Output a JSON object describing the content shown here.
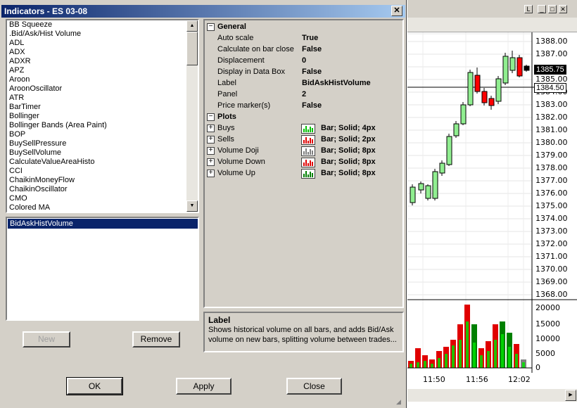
{
  "dialog": {
    "title": "Indicators - ES 03-08",
    "close_glyph": "✕",
    "indicator_list": [
      "BB Squeeze",
      ".Bid/Ask/Hist Volume",
      "ADL",
      "ADX",
      "ADXR",
      "APZ",
      "Aroon",
      "AroonOscillator",
      "ATR",
      "BarTimer",
      "Bollinger",
      "Bollinger Bands (Area Paint)",
      "BOP",
      "BuySellPressure",
      "BuySellVolume",
      "CalculateValueAreaHisto",
      "CCI",
      "ChaikinMoneyFlow",
      "ChaikinOscillator",
      "CMO",
      "Colored MA"
    ],
    "selected_indicators": [
      "BidAskHistVolume"
    ],
    "buttons": {
      "new": "New",
      "remove": "Remove",
      "ok": "OK",
      "apply": "Apply",
      "close": "Close"
    },
    "properties": {
      "general_label": "General",
      "general": [
        {
          "key": "Auto scale",
          "value": "True"
        },
        {
          "key": "Calculate on bar close",
          "value": "False"
        },
        {
          "key": "Displacement",
          "value": "0"
        },
        {
          "key": "Display in Data Box",
          "value": "False"
        },
        {
          "key": "Label",
          "value": "BidAskHistVolume"
        },
        {
          "key": "Panel",
          "value": "2"
        },
        {
          "key": "Price marker(s)",
          "value": "False"
        }
      ],
      "plots_label": "Plots",
      "plots": [
        {
          "key": "Buys",
          "value": "Bar; Solid; 4px",
          "color": "#00c000"
        },
        {
          "key": "Sells",
          "value": "Bar; Solid; 2px",
          "color": "#e00000"
        },
        {
          "key": "Volume Doji",
          "value": "Bar; Solid; 8px",
          "color": "#808080"
        },
        {
          "key": "Volume Down",
          "value": "Bar; Solid; 8px",
          "color": "#e00000"
        },
        {
          "key": "Volume Up",
          "value": "Bar; Solid; 8px",
          "color": "#008000"
        }
      ]
    },
    "description": {
      "title": "Label",
      "text": "Shows historical volume on all bars, and adds Bid/Ask volume on new bars, splitting volume between trades..."
    }
  },
  "chart_window": {
    "buttons": [
      "L",
      "_",
      "□",
      "✕"
    ],
    "price_labels": [
      "1388.00",
      "1387.00",
      "1385.00",
      "1384.00",
      "1383.00",
      "1382.00",
      "1381.00",
      "1380.00",
      "1379.00",
      "1378.00",
      "1377.00",
      "1376.00",
      "1375.00",
      "1374.00",
      "1373.00",
      "1372.00",
      "1371.00",
      "1370.00",
      "1369.00",
      "1368.00"
    ],
    "price_markers": [
      "1385.75",
      "1384.50"
    ],
    "volume_labels": [
      "20000",
      "15000",
      "10000",
      "5000",
      "0"
    ],
    "time_labels": [
      "11:50",
      "11:56",
      "12:02"
    ]
  }
}
